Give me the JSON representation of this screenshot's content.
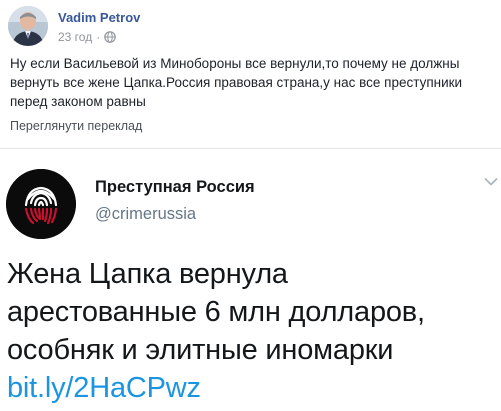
{
  "post": {
    "author_name": "Vadim Petrov",
    "timestamp": "23 год",
    "dot": "·",
    "privacy_icon": "globe-icon",
    "text": "Ну если Васильевой из Минобороны все вернули,то почему не должны вернуть все жене Цапка.Россия правовая страна,у нас все преступники перед законом равны",
    "translate_label": "Переглянути переклад"
  },
  "tweet": {
    "account_name": "Преступная Россия",
    "handle": "@crimerussia",
    "lines": [
      "Жена Цапка вернула",
      "арестованные 6 млн долларов,",
      "особняк и элитные иномарки"
    ],
    "link": "bit.ly/2HaCPwz",
    "menu_icon": "chevron-down-icon"
  },
  "colors": {
    "fb_name": "#365899",
    "fb_text": "#1d2129",
    "meta_gray": "#90949c",
    "tweet_link": "#1b95e0",
    "tweet_handle": "#657786",
    "logo_red": "#c8102e"
  }
}
